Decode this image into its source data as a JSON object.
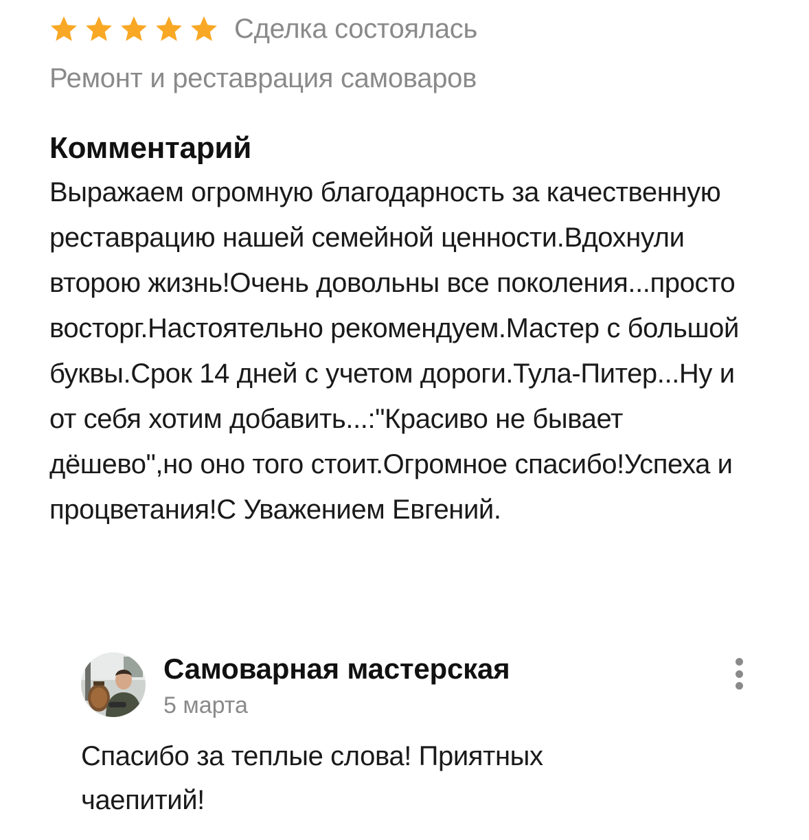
{
  "review": {
    "rating": 5,
    "rating_max": 5,
    "star_color": "#F9A825",
    "deal_status": "Сделка состоялась",
    "service": "Ремонт и реставрация самоваров",
    "comment_heading": "Комментарий",
    "comment_text": "Выражаем огромную благодарность за качественную реставрацию нашей семейной ценности.Вдохнули второю жизнь!Очень довольны все поколения...просто восторг.Настоятельно рекомендуем.Мастер с большой буквы.Срок 14 дней с учетом дороги.Тула-Питер...Ну и от себя хотим добавить...:\"Красиво не бывает дёшево\",но оно того стоит.Огромное спасибо!Успеха и процветания!С Уважением Евгений."
  },
  "reply": {
    "author": "Самоварная мастерская",
    "date": "5 марта",
    "text": "Спасибо за теплые слова! Приятных чаепитий!",
    "avatar_icon": "avatar-photo",
    "menu_icon": "more-vertical-icon"
  },
  "colors": {
    "muted_text": "#8A8A8A",
    "primary_text": "#1A1A1A",
    "star": "#F9A825"
  }
}
